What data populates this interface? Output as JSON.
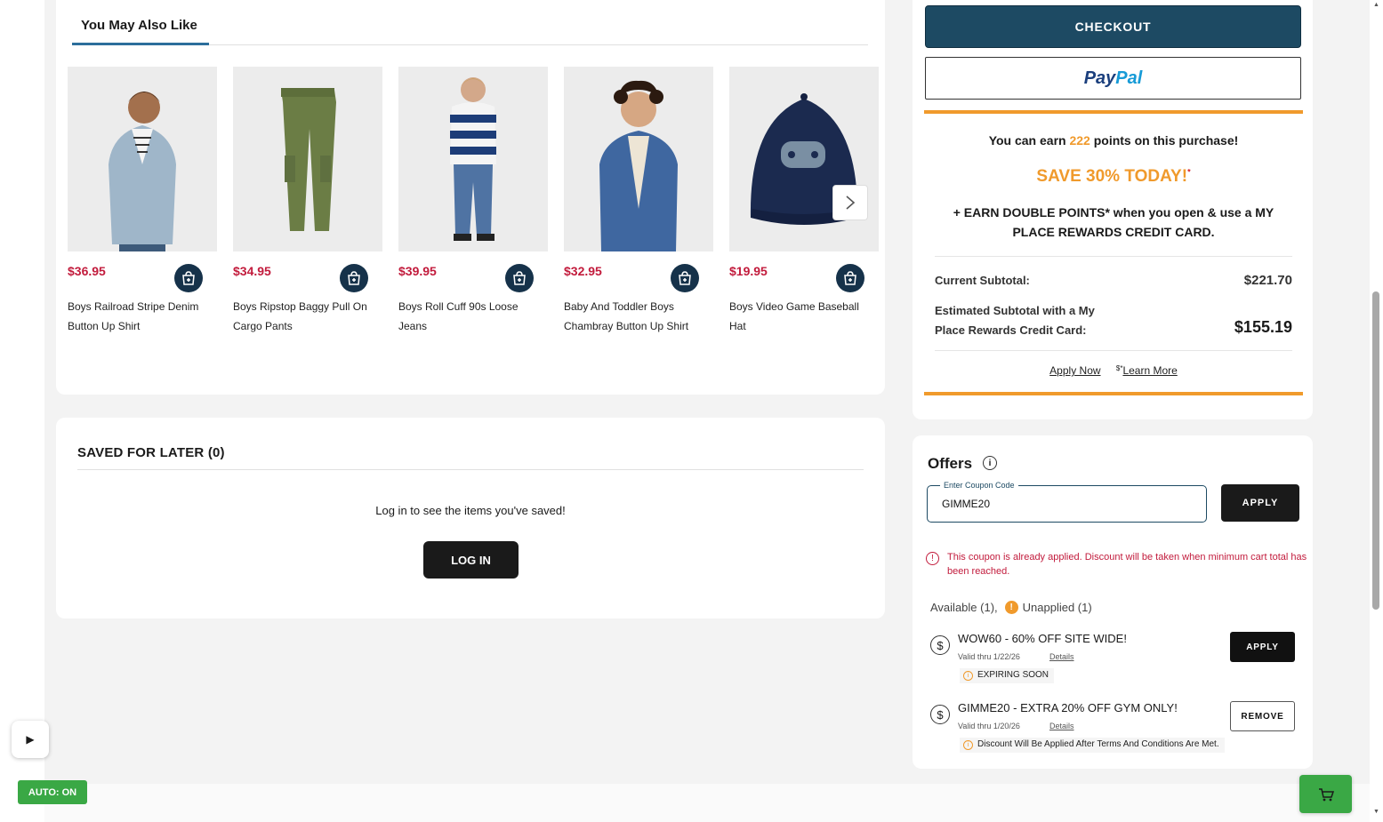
{
  "recommendations": {
    "tab_label": "You May Also Like",
    "products": [
      {
        "price": "$36.95",
        "name": "Boys Railroad Stripe Denim Button Up Shirt"
      },
      {
        "price": "$34.95",
        "name": "Boys Ripstop Baggy Pull On Cargo Pants"
      },
      {
        "price": "$39.95",
        "name": "Boys Roll Cuff 90s Loose Jeans"
      },
      {
        "price": "$32.95",
        "name": "Baby And Toddler Boys Chambray Button Up Shirt"
      },
      {
        "price": "$19.95",
        "name": "Boys Video Game Baseball Hat"
      }
    ]
  },
  "saved": {
    "title": "SAVED FOR LATER (0)",
    "message": "Log in to see the items you've saved!",
    "login_label": "LOG IN"
  },
  "summary": {
    "checkout_label": "CHECKOUT",
    "paypal_pay": "Pay",
    "paypal_pal": "Pal",
    "earn_prefix": "You can earn ",
    "earn_points": "222",
    "earn_suffix": " points on this purchase!",
    "save_text": "SAVE 30% TODAY!",
    "save_mark": "*",
    "double_points": "+ EARN DOUBLE POINTS* when you open & use a MY PLACE REWARDS CREDIT CARD.",
    "current_subtotal_label": "Current Subtotal:",
    "current_subtotal_value": "$221.70",
    "estimated_label": "Estimated Subtotal with a My Place Rewards Credit Card:",
    "estimated_value": "$155.19",
    "apply_now": "Apply Now",
    "learn_more_prefix": "$*",
    "learn_more": "Learn More"
  },
  "offers": {
    "title": "Offers",
    "coupon_legend": "Enter Coupon Code",
    "coupon_value": "GIMME20",
    "apply_label": "APPLY",
    "error": "This coupon is already applied. Discount will be taken when minimum cart total has been reached.",
    "available": "Available (1),",
    "unapplied": "Unapplied (1)",
    "list": [
      {
        "name": "WOW60 - 60% OFF SITE WIDE!",
        "valid": "Valid thru 1/22/26",
        "details": "Details",
        "note": "EXPIRING SOON",
        "button": "APPLY"
      },
      {
        "name": "GIMME20 - EXTRA 20% OFF GYM ONLY!",
        "valid": "Valid thru 1/20/26",
        "details": "Details",
        "note": "Discount Will Be Applied After Terms And Conditions Are Met.",
        "button": "REMOVE"
      }
    ]
  },
  "widgets": {
    "auto_label": "AUTO: ON"
  },
  "colors": {
    "accent": "#f09a2c",
    "checkout": "#1d4a63",
    "price": "#c21b3c",
    "auto": "#3aa845"
  }
}
